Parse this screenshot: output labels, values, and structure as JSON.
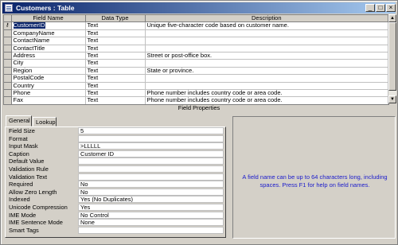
{
  "window": {
    "title": "Customers : Table",
    "controls": {
      "minimize": "_",
      "maximize": "□",
      "close": "×"
    }
  },
  "grid": {
    "columns": [
      "Field Name",
      "Data Type",
      "Description"
    ],
    "rows": [
      {
        "name": "CustomerID",
        "type": "Text",
        "description": "Unique five-character code based on customer name."
      },
      {
        "name": "CompanyName",
        "type": "Text",
        "description": ""
      },
      {
        "name": "ContactName",
        "type": "Text",
        "description": ""
      },
      {
        "name": "ContactTitle",
        "type": "Text",
        "description": ""
      },
      {
        "name": "Address",
        "type": "Text",
        "description": "Street or post-office box."
      },
      {
        "name": "City",
        "type": "Text",
        "description": ""
      },
      {
        "name": "Region",
        "type": "Text",
        "description": "State or province."
      },
      {
        "name": "PostalCode",
        "type": "Text",
        "description": ""
      },
      {
        "name": "Country",
        "type": "Text",
        "description": ""
      },
      {
        "name": "Phone",
        "type": "Text",
        "description": "Phone number includes country code or area code."
      },
      {
        "name": "Fax",
        "type": "Text",
        "description": "Phone number includes country code or area code."
      }
    ],
    "selected_row_icon": "primary-key-icon"
  },
  "field_properties": {
    "title": "Field Properties",
    "tabs": [
      "General",
      "Lookup"
    ],
    "active_tab": "General",
    "properties": [
      {
        "label": "Field Size",
        "value": "5"
      },
      {
        "label": "Format",
        "value": ""
      },
      {
        "label": "Input Mask",
        "value": ">LLLLL"
      },
      {
        "label": "Caption",
        "value": "Customer ID"
      },
      {
        "label": "Default Value",
        "value": ""
      },
      {
        "label": "Validation Rule",
        "value": ""
      },
      {
        "label": "Validation Text",
        "value": ""
      },
      {
        "label": "Required",
        "value": "No"
      },
      {
        "label": "Allow Zero Length",
        "value": "No"
      },
      {
        "label": "Indexed",
        "value": "Yes (No Duplicates)"
      },
      {
        "label": "Unicode Compression",
        "value": "Yes"
      },
      {
        "label": "IME Mode",
        "value": "No Control"
      },
      {
        "label": "IME Sentence Mode",
        "value": "None"
      },
      {
        "label": "Smart Tags",
        "value": ""
      }
    ],
    "help_text": "A field name can be up to 64 characters long, including spaces.  Press F1 for help on field names."
  },
  "colors": {
    "title_bar": "#0a246a",
    "selection": "#0a246a",
    "help_text": "#1a1acc",
    "face": "#d4d0c8"
  }
}
